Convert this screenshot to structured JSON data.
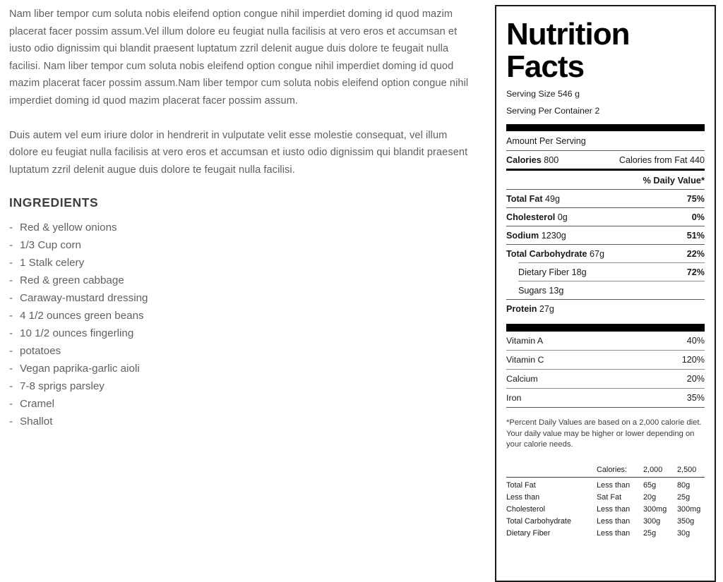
{
  "article": {
    "paragraphs": [
      "Nam liber tempor cum soluta nobis eleifend option congue nihil imperdiet doming id quod mazim placerat facer possim assum.Vel illum dolore eu feugiat nulla facilisis at vero eros et accumsan et iusto odio dignissim qui blandit praesent luptatum zzril delenit augue duis dolore te feugait nulla facilisi. Nam liber tempor cum soluta nobis eleifend option congue nihil imperdiet doming id quod mazim placerat facer possim assum.Nam liber tempor cum soluta nobis eleifend option congue nihil imperdiet doming id quod mazim placerat facer possim assum.",
      "Duis autem vel eum iriure dolor in hendrerit in vulputate velit esse molestie consequat, vel illum dolore eu feugiat nulla facilisis at vero eros et accumsan et iusto odio dignissim qui blandit praesent luptatum zzril delenit augue duis dolore te feugait nulla facilisi."
    ],
    "ingredients_heading": "INGREDIENTS",
    "bullet_mark": "-",
    "ingredients": [
      "Red & yellow onions",
      "1/3 Cup corn",
      "1 Stalk celery",
      "Red & green cabbage",
      "Caraway-mustard dressing",
      "4 1/2 ounces green beans",
      "10 1/2 ounces fingerling",
      "potatoes",
      "Vegan paprika-garlic aioli",
      "7-8 sprigs parsley",
      "Cramel",
      "Shallot"
    ]
  },
  "nutrition": {
    "title_line1": "Nutrition",
    "title_line2": "Facts",
    "serving_size": "Serving Size 546 g",
    "serving_per_container": "Serving Per Container 2",
    "amount_per_serving": "Amount Per Serving",
    "calories_label": "Calories",
    "calories_value": "800",
    "calories_from_fat": "Calories from Fat 440",
    "daily_value_header": "% Daily Value*",
    "rows": [
      {
        "label": "Total Fat",
        "amount": "49g",
        "dv": "75%"
      },
      {
        "label": "Cholesterol",
        "amount": "0g",
        "dv": "0%"
      },
      {
        "label": "Sodium",
        "amount": "1230g",
        "dv": "51%"
      },
      {
        "label": "Total Carbohydrate",
        "amount": "67g",
        "dv": "22%"
      }
    ],
    "sub_rows": [
      {
        "label": "Dietary Fiber",
        "amount": "18g",
        "dv": "72%"
      },
      {
        "label": "Sugars",
        "amount": "13g",
        "dv": ""
      }
    ],
    "protein": {
      "label": "Protein",
      "amount": "27g"
    },
    "vitamins": [
      {
        "label": "Vitamin A",
        "dv": "40%"
      },
      {
        "label": "Vitamin C",
        "dv": "120%"
      },
      {
        "label": "Calcium",
        "dv": "20%"
      },
      {
        "label": "Iron",
        "dv": "35%"
      }
    ],
    "footnote": "*Percent Daily Values are based on a 2,000 calorie diet. Your daily value may be higher or lower depending on your calorie needs.",
    "dv_table": {
      "headers": [
        "",
        "Calories:",
        "2,000",
        "2,500"
      ],
      "rows": [
        [
          "Total Fat",
          "Less than",
          "65g",
          "80g"
        ],
        [
          "Less than",
          "Sat Fat",
          "20g",
          "25g"
        ],
        [
          "Cholesterol",
          "Less than",
          "300mg",
          "300mg"
        ],
        [
          "Total Carbohydrate",
          "Less than",
          "300g",
          "350g"
        ],
        [
          "Dietary Fiber",
          "Less than",
          "25g",
          "30g"
        ]
      ]
    }
  },
  "colors": {
    "panel_border": "#1a1a1a",
    "bar_black": "#000000",
    "body_text": "#5d6163",
    "heading_text": "#3b3f42"
  }
}
